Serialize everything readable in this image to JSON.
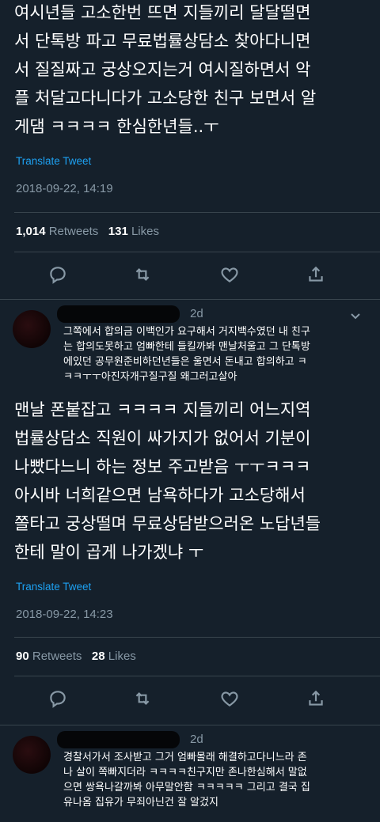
{
  "tweet1": {
    "text": "여시년들 고소한번 뜨면 지들끼리 달달떨면\n서 단톡방 파고 무료법률상담소 찾아다니면\n서 질질짜고 궁상오지는거 여시질하면서 악\n플 처달고다니다가 고소당한 친구 보면서 알\n게댐 ㅋㅋㅋㅋ 한심한년들..ㅜ",
    "translate": "Translate Tweet",
    "timestamp": "2018-09-22, 14:19",
    "retweets": "1,014",
    "retweets_label": "Retweets",
    "likes": "131",
    "likes_label": "Likes"
  },
  "reply1": {
    "time": "2d",
    "text": "그쪽에서 합의금 이백인가 요구해서 거지백수였던 내 친구\n는 합의도못하고 엄빠한테 들킬까봐 맨날처울고 그 단톡방\n에있던 공무원준비하던년들은 울면서 돈내고 합의하고 ㅋ\nㅋㅋㅜㅜ아진자개구질구질 왜그러고살아"
  },
  "tweet2": {
    "text": "맨날 폰붙잡고 ㅋㅋㅋㅋ 지들끼리 어느지역\n법률상담소 직원이 싸가지가 없어서 기분이\n나빴다느니 하는 정보 주고받음 ㅜㅜㅋㅋㅋ\n아시바 너희같으면 남욕하다가 고소당해서\n쫄타고 궁상떨며 무료상담받으러온 노답년들\n한테 말이 곱게 나가겠냐 ㅜ",
    "translate": "Translate Tweet",
    "timestamp": "2018-09-22, 14:23",
    "retweets": "90",
    "retweets_label": "Retweets",
    "likes": "28",
    "likes_label": "Likes"
  },
  "reply2": {
    "time": "2d",
    "text": "경찰서가서 조사받고 그거 엄빠몰래 해결하고다니느라 존\n나 살이 쪽빠지더라 ㅋㅋㅋㅋ친구지만 존나한심해서 말없\n으면 쌍욕나갈까봐 아무말안함 ㅋㅋㅋㅋㅋ 그리고 결국 집\n유나옴 집유가 무죄아닌건 잘 알겄지"
  },
  "icons": [
    "reply-icon",
    "retweet-icon",
    "like-icon",
    "share-icon",
    "chevron-down-icon"
  ],
  "colors": {
    "background": "#15202b",
    "link": "#1da1f2",
    "muted": "#8899a6"
  }
}
